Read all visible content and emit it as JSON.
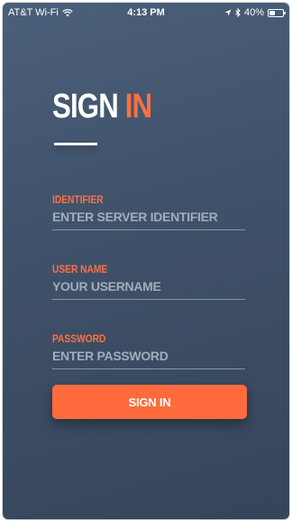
{
  "status_bar": {
    "carrier": "AT&T Wi-Fi",
    "time": "4:13 PM",
    "battery": "40%",
    "battery_level": 0.4,
    "icons": [
      "wifi-icon",
      "location-arrow-icon",
      "bluetooth-icon",
      "battery-icon"
    ]
  },
  "title": {
    "part1": "SIGN",
    "part2": "IN"
  },
  "fields": {
    "identifier": {
      "label": "IDENTIFIER",
      "value": "",
      "placeholder": "ENTER SERVER IDENTIFIER"
    },
    "username": {
      "label": "USER NAME",
      "value": "",
      "placeholder": "YOUR USERNAME"
    },
    "password": {
      "label": "PASSWORD",
      "value": "",
      "placeholder": "ENTER PASSWORD"
    }
  },
  "button": {
    "label": "SIGN IN"
  },
  "colors": {
    "accent": "#ff7043",
    "background": "#45576f",
    "text": "#ffffff"
  }
}
